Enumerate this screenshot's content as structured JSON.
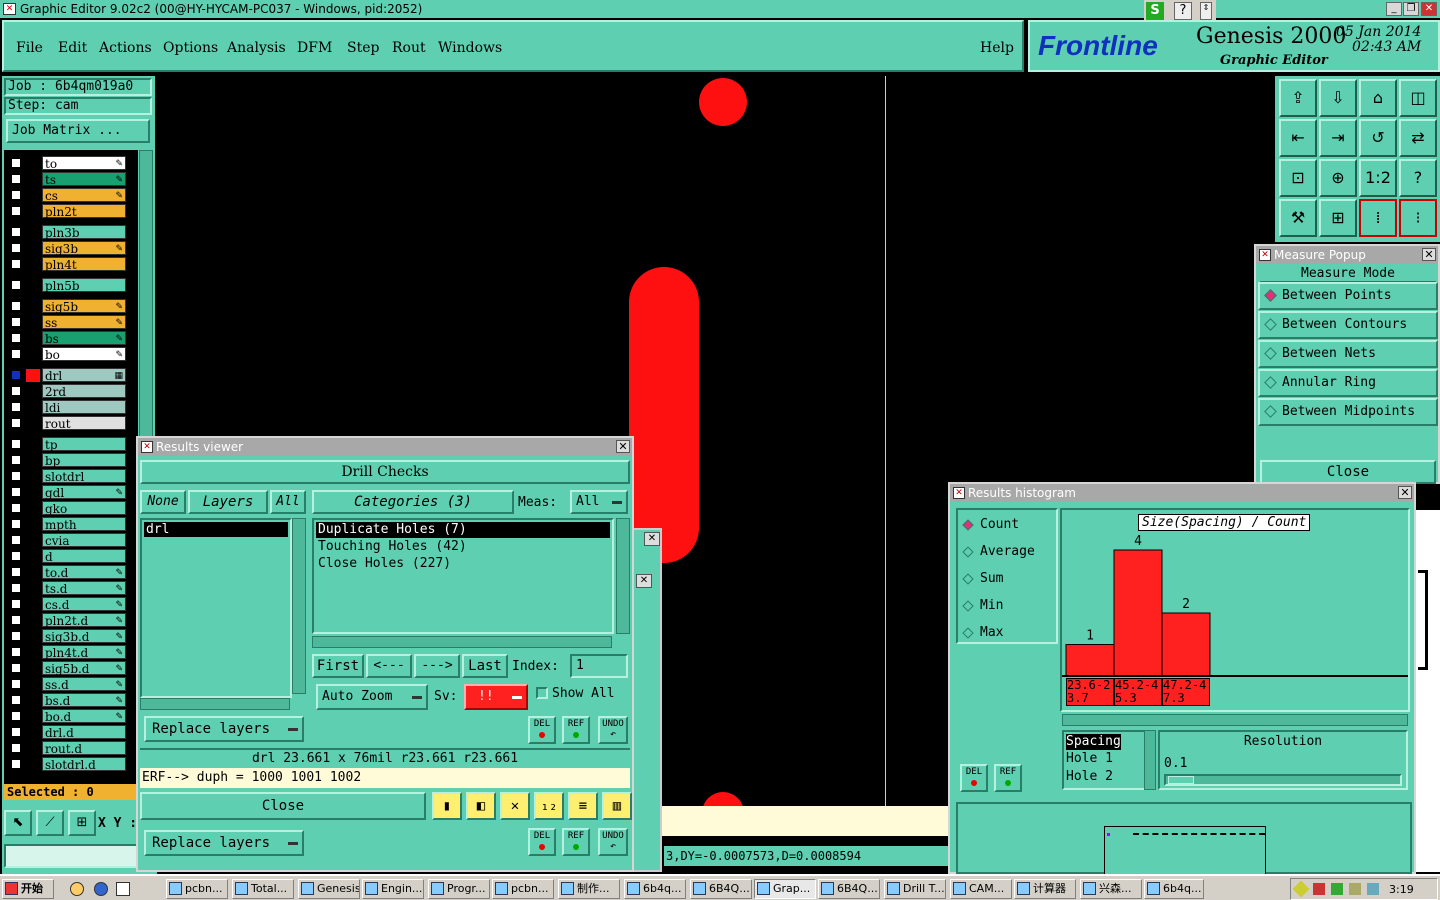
{
  "window_title": "Graphic Editor 9.02c2 (00@HY-HYCAM-PC037 - Windows, pid:2052)",
  "menu": [
    "File",
    "Edit",
    "Actions",
    "Options",
    "Analysis",
    "DFM",
    "Step",
    "Rout",
    "Windows"
  ],
  "menu_help": "Help",
  "brand": {
    "logo": "Frontline",
    "product": "Genesis 2000",
    "subtitle": "Graphic Editor",
    "date": "05 Jan 2014",
    "time": "02:43 AM"
  },
  "job": {
    "job_label": "Job  :  6b4qm019a0",
    "step_label": "Step:  cam",
    "matrix_button": "Job Matrix ..."
  },
  "layers": [
    {
      "name": "to",
      "color": "#ffffff",
      "mark": "✎"
    },
    {
      "name": "ts",
      "color": "#19a070",
      "mark": "✎"
    },
    {
      "name": "cs",
      "color": "#f0b030",
      "mark": "✎"
    },
    {
      "name": "pln2t",
      "color": "#f0b030",
      "mark": ""
    },
    {
      "name": "pln3b",
      "color": "#5ecfb0",
      "mark": ""
    },
    {
      "name": "sig3b",
      "color": "#f0b030",
      "mark": "✎"
    },
    {
      "name": "pln4t",
      "color": "#f0b030",
      "mark": ""
    },
    {
      "name": "pln5b",
      "color": "#5ecfb0",
      "mark": ""
    },
    {
      "name": "sig5b",
      "color": "#f0b030",
      "mark": "✎"
    },
    {
      "name": "ss",
      "color": "#f0b030",
      "mark": "✎"
    },
    {
      "name": "bs",
      "color": "#19a070",
      "mark": "✎"
    },
    {
      "name": "bo",
      "color": "#ffffff",
      "mark": "✎"
    },
    {
      "name": "drl",
      "color": "#9ec8c0",
      "mark": "▦"
    },
    {
      "name": "2rd",
      "color": "#9ec8c0",
      "mark": ""
    },
    {
      "name": "ldi",
      "color": "#9ec8c0",
      "mark": ""
    },
    {
      "name": "rout",
      "color": "#e0e0e0",
      "mark": ""
    },
    {
      "name": "tp",
      "color": "#5ecfb0",
      "mark": ""
    },
    {
      "name": "bp",
      "color": "#5ecfb0",
      "mark": ""
    },
    {
      "name": "slotdrl",
      "color": "#5ecfb0",
      "mark": ""
    },
    {
      "name": "gdl",
      "color": "#5ecfb0",
      "mark": "✎"
    },
    {
      "name": "gko",
      "color": "#5ecfb0",
      "mark": ""
    },
    {
      "name": "mpth",
      "color": "#5ecfb0",
      "mark": ""
    },
    {
      "name": "cvia",
      "color": "#5ecfb0",
      "mark": ""
    },
    {
      "name": "d",
      "color": "#5ecfb0",
      "mark": ""
    },
    {
      "name": "to.d",
      "color": "#5ecfb0",
      "mark": "✎"
    },
    {
      "name": "ts.d",
      "color": "#5ecfb0",
      "mark": "✎"
    },
    {
      "name": "cs.d",
      "color": "#5ecfb0",
      "mark": "✎"
    },
    {
      "name": "pln2t.d",
      "color": "#5ecfb0",
      "mark": "✎"
    },
    {
      "name": "sig3b.d",
      "color": "#5ecfb0",
      "mark": "✎"
    },
    {
      "name": "pln4t.d",
      "color": "#5ecfb0",
      "mark": "✎"
    },
    {
      "name": "sig5b.d",
      "color": "#5ecfb0",
      "mark": "✎"
    },
    {
      "name": "ss.d",
      "color": "#5ecfb0",
      "mark": "✎"
    },
    {
      "name": "bs.d",
      "color": "#5ecfb0",
      "mark": "✎"
    },
    {
      "name": "bo.d",
      "color": "#5ecfb0",
      "mark": "✎"
    },
    {
      "name": "drl.d",
      "color": "#5ecfb0",
      "mark": ""
    },
    {
      "name": "rout.d",
      "color": "#5ecfb0",
      "mark": ""
    },
    {
      "name": "slotdrl.d",
      "color": "#5ecfb0",
      "mark": ""
    }
  ],
  "selected": "Selected : 0",
  "xy_label": "X Y :",
  "toolbar_icons": [
    "open-icon",
    "save-icon",
    "home-icon",
    "window-icon",
    "layer-left-icon",
    "layer-right-icon",
    "rotate-icon",
    "swap-icon",
    "fit-icon",
    "zoom-icon",
    "ratio-label",
    "help-icon",
    "tools-icon",
    "grid-icon",
    "snap-icon",
    "net-icon"
  ],
  "toolbar_ratio": "1:2",
  "toolbar_help": "?",
  "measure": {
    "title": "Measure Popup",
    "mode_label": "Measure Mode",
    "options": [
      "Between Points",
      "Between Contours",
      "Between Nets",
      "Annular Ring",
      "Between Midpoints"
    ],
    "selected": 0,
    "close": "Close"
  },
  "results_viewer": {
    "title": "Results viewer",
    "header": "Drill Checks",
    "none": "None",
    "layers": "Layers",
    "all": "All",
    "categories": "Categories (3)",
    "meas_label": "Meas:",
    "meas_value": "All",
    "layer_items": [
      "drl"
    ],
    "category_items": [
      "Duplicate Holes (7)",
      "Touching Holes (42)",
      "Close Holes (227)"
    ],
    "first": "First",
    "prev": "<---",
    "next": "--->",
    "last": "Last",
    "index_label": "Index:",
    "index_value": "1",
    "auto_zoom": "Auto Zoom",
    "sv_label": "Sv:",
    "sv_value": "!!",
    "show_all": "Show All",
    "replace_layers": "Replace layers",
    "del": "DEL",
    "ref": "REF",
    "undo": "UNDO",
    "info_line": "drl  23.661 x 76mil   r23.661   r23.661",
    "erf_line": "ERF--> duph = 1000 1001 1002",
    "close": "Close",
    "replace_layers_2": "Replace layers"
  },
  "histogram": {
    "title": "Results histogram",
    "modes": [
      "Count",
      "Average",
      "Sum",
      "Min",
      "Max"
    ],
    "mode_selected": 0,
    "chart_title": "Size(Spacing) / Count",
    "del": "DEL",
    "ref": "REF",
    "list_items": [
      "Spacing",
      "Hole  1",
      "Hole  2"
    ],
    "resolution_label": "Resolution",
    "resolution_value": "0.1"
  },
  "chart_data": {
    "type": "bar",
    "title": "Size(Spacing) / Count",
    "categories": [
      "23.6-23.7",
      "45.2-45.3",
      "47.2-47.3"
    ],
    "values": [
      1,
      4,
      2
    ],
    "bar_color": "#ff2020"
  },
  "status_line": "3,DY=-0.0007573,D=0.0008594",
  "taskbar": {
    "start": "开始",
    "items": [
      "pcbn...",
      "Total...",
      "Genesis",
      "Engin...",
      "Progr...",
      "pcbn...",
      "制作...",
      "6b4q...",
      "6B4Q...",
      "Grap...",
      "6B4Q...",
      "Drill T...",
      "CAM...",
      "计算器",
      "兴森...",
      "6b4q..."
    ],
    "active": 9,
    "clock": "3:19"
  }
}
